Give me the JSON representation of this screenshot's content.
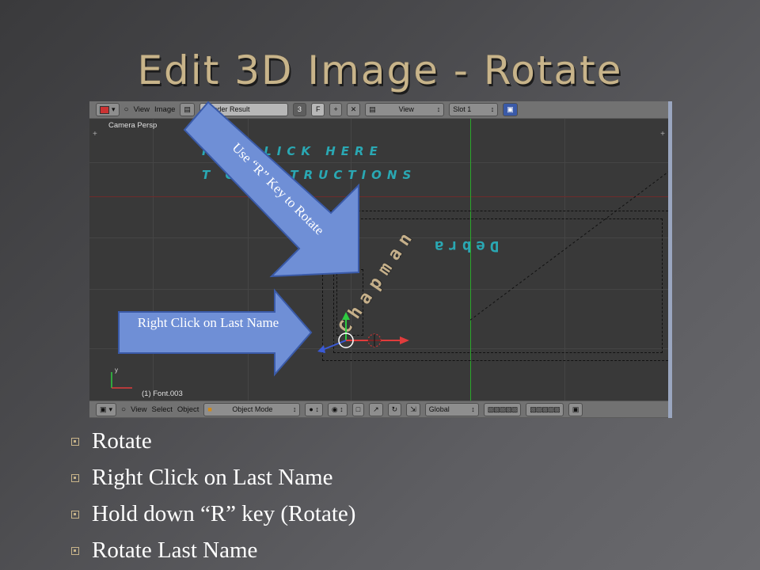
{
  "slide": {
    "title": "Edit 3D Image - Rotate",
    "bullets": [
      "Rotate",
      "Right Click on Last Name",
      "Hold down “R” key (Rotate)",
      "Rotate Last Name"
    ]
  },
  "blender": {
    "top_bar": {
      "view": "View",
      "image": "Image",
      "render_result": "Render Result",
      "slot_num": "3",
      "f_label": "F",
      "view_dropdown": "View",
      "slot": "Slot 1"
    },
    "viewport": {
      "camera_label": "Camera Persp",
      "hint_line1": "R   T CLICK HERE",
      "hint_line2": "T O     INSTRUCTIONS",
      "last_name": "Chapman",
      "first_name": "Debra",
      "object_label": "(1) Font.003",
      "axis_y": "y"
    },
    "bottom_bar": {
      "view": "View",
      "select": "Select",
      "object": "Object",
      "mode": "Object Mode",
      "orientation": "Global"
    }
  },
  "annotations": {
    "rotate_arrow": "Use “R” Key to Rotate",
    "click_arrow": "Right Click on Last Name"
  },
  "colors": {
    "title": "#c8b48a",
    "arrow_fill": "#6f8fd6",
    "arrow_stroke": "#3a5aa8",
    "hint_text": "#2aa8b3"
  }
}
